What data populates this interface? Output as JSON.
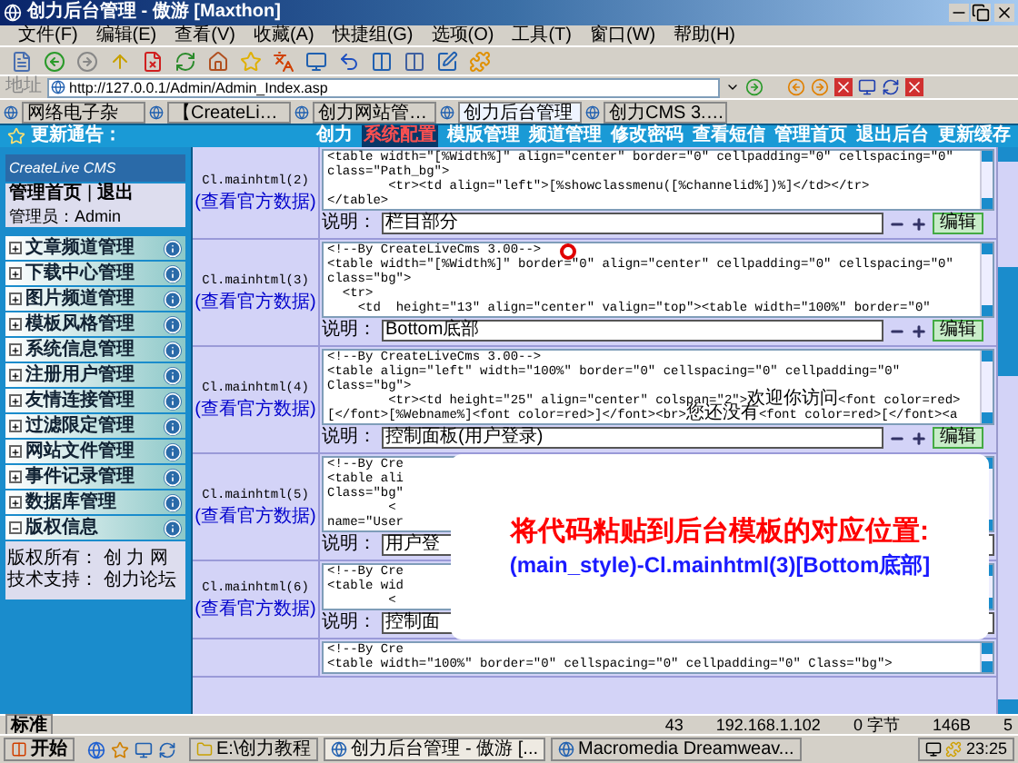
{
  "window": {
    "title": "创力后台管理 - 傲游 [Maxthon]"
  },
  "menu": [
    "文件(F)",
    "编辑(E)",
    "查看(V)",
    "收藏(A)",
    "快捷组(G)",
    "选项(O)",
    "工具(T)",
    "窗口(W)",
    "帮助(H)"
  ],
  "address": {
    "label": "地址",
    "value": "http://127.0.0.1/Admin/Admin_Index.asp"
  },
  "tabs": [
    {
      "label": "网络电子杂",
      "selected": false
    },
    {
      "label": "【CreateLi…",
      "selected": false
    },
    {
      "label": "创力网站管…",
      "selected": false
    },
    {
      "label": "创力后台管理",
      "selected": true
    },
    {
      "label": "创力CMS 3.…",
      "selected": false
    }
  ],
  "notice": "更新通告：",
  "nav": [
    {
      "label": "创力",
      "selected": false
    },
    {
      "label": "系统配置",
      "selected": true
    },
    {
      "label": "模版管理",
      "selected": false
    },
    {
      "label": "频道管理",
      "selected": false
    },
    {
      "label": "修改密码",
      "selected": false
    },
    {
      "label": "查看短信",
      "selected": false
    },
    {
      "label": "管理首页",
      "selected": false
    },
    {
      "label": "退出后台",
      "selected": false
    },
    {
      "label": "更新缓存",
      "selected": false
    }
  ],
  "sidebar": {
    "logo": "CreateLive CMS",
    "links": [
      "管理首页",
      "退出"
    ],
    "separator": "|",
    "admin": "管理员：Admin",
    "items": [
      {
        "label": "文章频道管理",
        "expanded": false
      },
      {
        "label": "下载中心管理",
        "expanded": false
      },
      {
        "label": "图片频道管理",
        "expanded": false
      },
      {
        "label": "模板风格管理",
        "expanded": false
      },
      {
        "label": "系统信息管理",
        "expanded": false
      },
      {
        "label": "注册用户管理",
        "expanded": false
      },
      {
        "label": "友情连接管理",
        "expanded": false
      },
      {
        "label": "过滤限定管理",
        "expanded": false
      },
      {
        "label": "网站文件管理",
        "expanded": false
      },
      {
        "label": "事件记录管理",
        "expanded": false
      },
      {
        "label": "数据库管理",
        "expanded": false
      },
      {
        "label": "版权信息",
        "expanded": true
      }
    ],
    "info": [
      "版权所有： 创 力 网",
      "技术支持： 创力论坛"
    ]
  },
  "rows": [
    {
      "name": "Cl.mainhtml(2)",
      "link": "(查看官方数据)",
      "code": [
        "<table width=\"[%Width%]\" align=\"center\" border=\"0\" cellpadding=\"0\" cellspacing=\"0\"",
        "class=\"Path_bg\">",
        "        <tr><td align=\"left\">[%showclassmenu([%channelid%])%]</td></tr>",
        "</table>"
      ],
      "label": "说明：",
      "description": "栏目部分",
      "button": "编辑"
    },
    {
      "name": "Cl.mainhtml(3)",
      "link": "(查看官方数据)",
      "code": [
        "<!--By CreateLiveCms 3.00-->",
        "<table width=\"[%Width%]\" border=\"0\" align=\"center\" cellpadding=\"0\" cellspacing=\"0\"",
        "class=\"bg\">",
        "  <tr>",
        "    <td  height=\"13\" align=\"center\" valign=\"top\"><table width=\"100%\" border=\"0\""
      ],
      "label": "说明：",
      "description": "Bottom底部",
      "button": "编辑",
      "cursor": true
    },
    {
      "name": "Cl.mainhtml(4)",
      "link": "(查看官方数据)",
      "code": [
        "<!--By CreateLiveCms 3.00-->",
        "<table align=\"left\" width=\"100%\" border=\"0\" cellspacing=\"0\" cellpadding=\"0\"",
        "Class=\"bg\">",
        "        <tr><td height=\"25\" align=\"center\" colspan=\"2\">欢迎你访问<font color=red>",
        "[</font>[%Webname%]<font color=red>]</font><br>您还没有<font color=red>[</font><a"
      ],
      "label": "说明：",
      "description": "控制面板(用户登录)",
      "button": "编辑"
    },
    {
      "name": "Cl.mainhtml(5)",
      "link": "(查看官方数据)",
      "code": [
        "<!--By Cre",
        "<table ali",
        "Class=\"bg\"",
        "        <",
        "name=\"User"
      ],
      "label": "说明：",
      "description": "用户登"
    },
    {
      "name": "Cl.mainhtml(6)",
      "link": "(查看官方数据)",
      "code": [
        "<!--By Cre",
        "<table wid",
        "        <"
      ],
      "label": "说明：",
      "description": "控制面"
    },
    {
      "code": [
        "<!--By Cre",
        "<table width=\"100%\" border=\"0\" cellspacing=\"0\" cellpadding=\"0\" Class=\"bg\">"
      ]
    }
  ],
  "callout": {
    "title": "将代码粘贴到后台模板的对应位置:",
    "detail": "(main_style)-Cl.mainhtml(3)[Bottom底部]"
  },
  "status": {
    "mode": "标准",
    "items": [
      "43",
      "192.168.1.102",
      "0 字节",
      "146B",
      "5"
    ]
  },
  "taskbar": {
    "start": "开始",
    "windows": [
      {
        "label": "E:\\创力教程",
        "selected": false
      },
      {
        "label": "创力后台管理 - 傲游 [...",
        "selected": true
      },
      {
        "label": "Macromedia Dreamweav...",
        "selected": false
      }
    ],
    "clock": "23:25"
  }
}
